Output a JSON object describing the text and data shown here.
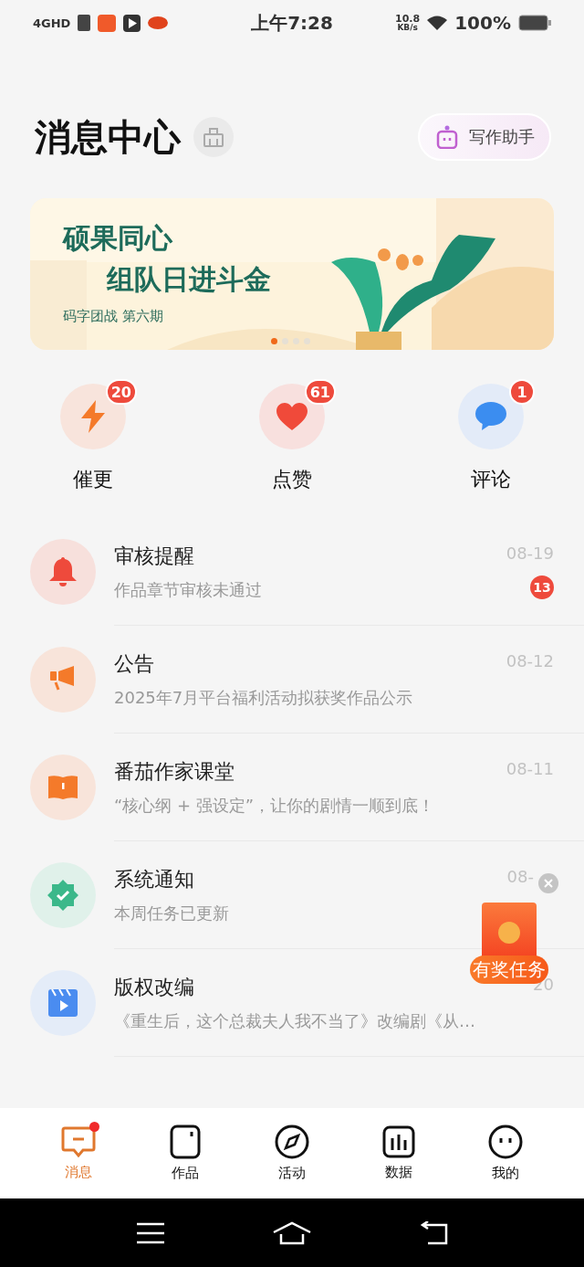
{
  "status_bar": {
    "network": "4GHD",
    "time": "上午7:28",
    "speed": "10.8",
    "speed_unit": "KB/s",
    "battery": "100%"
  },
  "header": {
    "title": "消息中心",
    "assistant_button": "写作助手"
  },
  "banner": {
    "kind": "picture",
    "headline": "硕果同心",
    "headline_2": "组队日进斗金",
    "caption": "码字团战 第六期",
    "dots": [
      {
        "selected": true
      },
      {
        "selected": false
      },
      {
        "selected": false
      },
      {
        "selected": false
      }
    ]
  },
  "shortcuts": [
    {
      "kind": "bolt",
      "label": "催更",
      "badge": "20"
    },
    {
      "kind": "heart",
      "label": "点赞",
      "badge": "61"
    },
    {
      "kind": "comment",
      "label": "评论",
      "badge": "1"
    }
  ],
  "messages": [
    {
      "kind": "bell",
      "title": "审核提醒",
      "subtitle": "作品章节审核未通过",
      "date": "08-19",
      "badge": "13"
    },
    {
      "kind": "megaphone",
      "title": "公告",
      "subtitle": "2025年7月平台福利活动拟获奖作品公示",
      "date": "08-12"
    },
    {
      "kind": "book",
      "title": "番茄作家课堂",
      "subtitle": "“核心纲 + 强设定”，让你的剧情一顺到底！",
      "date": "08-11"
    },
    {
      "kind": "verified",
      "title": "系统通知",
      "subtitle": "本周任务已更新",
      "date": "08-"
    },
    {
      "kind": "video",
      "title": "版权改编",
      "subtitle": "《重生后，这个总裁夫人我不当了》改编剧《从…",
      "date": "20"
    }
  ],
  "floating_reward": {
    "label": "有奖任务"
  },
  "tab_bar": [
    {
      "kind": "message",
      "label": "消息",
      "selected": true,
      "dot": true
    },
    {
      "kind": "works",
      "label": "作品",
      "selected": false,
      "dot": false
    },
    {
      "kind": "compass",
      "label": "活动",
      "selected": false,
      "dot": false
    },
    {
      "kind": "chart",
      "label": "数据",
      "selected": false,
      "dot": false
    },
    {
      "kind": "face",
      "label": "我的",
      "selected": false,
      "dot": false
    }
  ]
}
